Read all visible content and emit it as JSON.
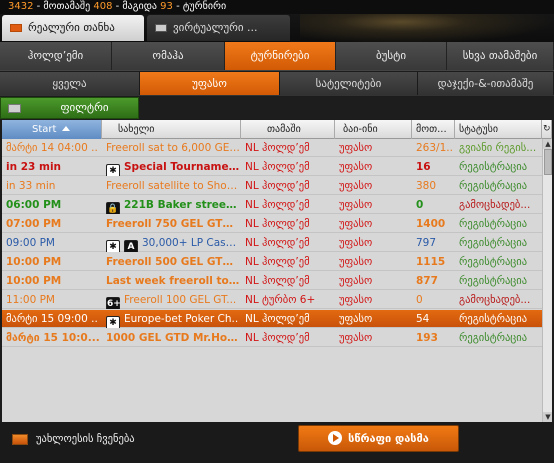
{
  "header": {
    "players_count": "3432",
    "players_label": "- მოთამაშე",
    "tables_count": "408",
    "tables_label": "- მაგიდა",
    "tournaments_count": "93",
    "tournaments_label": "- ტურნირი"
  },
  "main_tabs": [
    {
      "label": "რეალური თანხა"
    },
    {
      "label": "ვირტუალური ..."
    }
  ],
  "nav1": [
    {
      "label": "ჰოლდ’ემი"
    },
    {
      "label": "ომაჰა"
    },
    {
      "label": "ტურნირები"
    },
    {
      "label": "ბუსტი"
    },
    {
      "label": "სხვა თამაშები"
    }
  ],
  "nav2": [
    {
      "label": "ყველა"
    },
    {
      "label": "უფასო"
    },
    {
      "label": "სატელიტები"
    },
    {
      "label": "დაჯექი-&-ითამაშე"
    }
  ],
  "filter": {
    "label": "ფილტრი"
  },
  "table": {
    "headers": [
      "Start",
      "სახელი",
      "თამაში",
      "ბაი-ინი",
      "მოთ...",
      "სტატუსი"
    ],
    "rows": [
      {
        "start": "მარტი 14 04:00 ..",
        "name": "Freeroll sat to  6,000 GEL..",
        "game": "NL ჰოლდ’ემ",
        "limit": "უფასო",
        "players": "263/1..",
        "status": "გვიანი რეგის..."
      },
      {
        "start": "in 23 min",
        "name": "Special Tournament",
        "game": "NL ჰოლდ’ემ",
        "limit": "უფასო",
        "players": "16",
        "status": "რეგისტრაცია"
      },
      {
        "start": "in 33 min",
        "name": "Freeroll satellite to Shooto..",
        "game": "NL ჰოლდ’ემ",
        "limit": "უფასო",
        "players": "380",
        "status": "რეგისტრაცია"
      },
      {
        "start": "06:00 PM",
        "name": "221B Baker street ...",
        "game": "NL ჰოლდ’ემ",
        "limit": "უფასო",
        "players": "0",
        "status": "გამოცხადებ..."
      },
      {
        "start": "07:00 PM",
        "name": "Freeroll 750 GEL GTD ...",
        "game": "NL ჰოლდ’ემ",
        "limit": "უფასო",
        "players": "1400",
        "status": "რეგისტრაცია"
      },
      {
        "start": "09:00 PM",
        "name": "30,000+ LP Cash...",
        "game": "NL ჰოლდ’ემ",
        "limit": "უფასო",
        "players": "797",
        "status": "რეგისტრაცია"
      },
      {
        "start": "10:00 PM",
        "name": "Freeroll 500 GEL GTD ...",
        "game": "NL ჰოლდ’ემ",
        "limit": "უფასო",
        "players": "1115",
        "status": "რეგისტრაცია"
      },
      {
        "start": "10:00 PM",
        "name": "Last week freeroll to eur..",
        "game": "NL ჰოლდ’ემ",
        "limit": "უფასო",
        "players": "877",
        "status": "რეგისტრაცია"
      },
      {
        "start": "11:00 PM",
        "name": "Freeroll 100 GEL GT...",
        "game": "NL ტურბო 6+",
        "limit": "უფასო",
        "players": "0",
        "status": "გამოცხადებ..."
      },
      {
        "start": "მარტი 15 09:00 ..",
        "name": "Europe-bet Poker Ch..",
        "game": "NL ჰოლდ’ემ",
        "limit": "უფასო",
        "players": "54",
        "status": "რეგისტრაცია"
      },
      {
        "start": "მარტი 15 10:0...",
        "name": "1000 GEL GTD Mr.Hol...",
        "game": "NL ჰოლდ’ემ",
        "limit": "უფასო",
        "players": "193",
        "status": "რეგისტრაცია"
      }
    ]
  },
  "bottom": {
    "legend_label": "უახლოესის ჩვენება",
    "quick_button": "სწრაფი დასმა"
  },
  "colors": {
    "accent_orange": "#e36a10",
    "filter_green": "#3d8a22",
    "status_red": "#d21414",
    "status_green": "#23901a"
  }
}
